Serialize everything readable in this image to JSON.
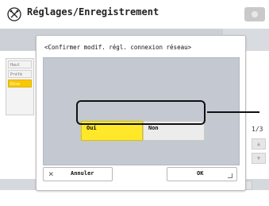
{
  "header": {
    "title": "Réglages/Enregistrement",
    "icon": "tools-circle-icon"
  },
  "background": {
    "tabs": [
      "Haut",
      "Préfé",
      "Rése"
    ],
    "page_indicator": "1/3"
  },
  "dialog": {
    "title": "<Confirmer modif. régl. connexion réseau>",
    "options": {
      "oui": "Oui",
      "non": "Non"
    },
    "cancel_label": "Annuler",
    "ok_label": "OK"
  },
  "colors": {
    "accent_yellow": "#ffe82a",
    "panel_gray": "#c4c8d0",
    "highlight_black": "#111111"
  }
}
